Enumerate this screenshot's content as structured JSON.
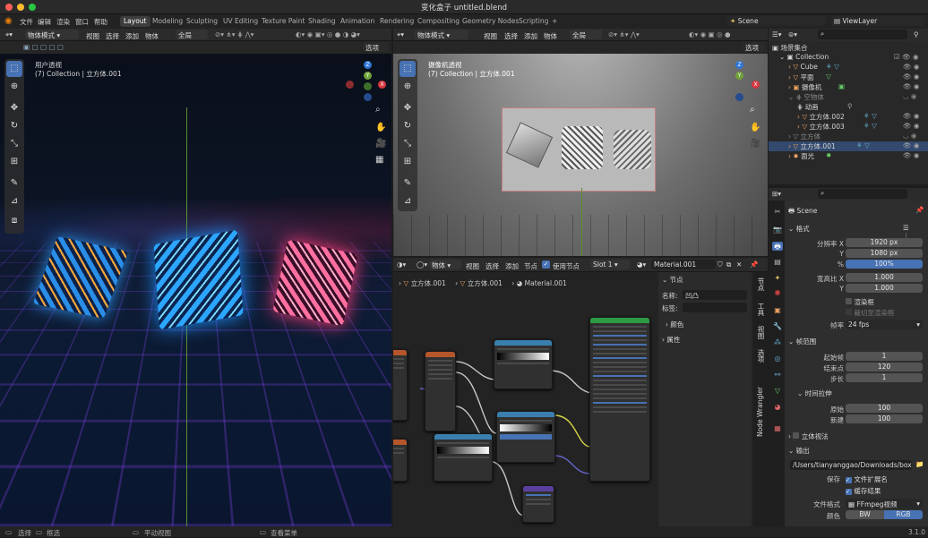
{
  "titlebar": {
    "title": "变化盒子 untitled.blend",
    "colors": {
      "close": "#ff5f57",
      "min": "#febc2e",
      "max": "#28c840"
    }
  },
  "menubar": {
    "items": [
      "文件",
      "编辑",
      "渲染",
      "窗口",
      "帮助"
    ],
    "tabs": [
      "Layout",
      "Modeling",
      "Sculpting",
      "UV Editing",
      "Texture Paint",
      "Shading",
      "Animation",
      "Rendering",
      "Compositing",
      "Geometry Nodes",
      "Scripting"
    ],
    "active_tab": "Layout",
    "add_tab": "+",
    "scene": "Scene",
    "viewlayer": "ViewLayer"
  },
  "viewport_left": {
    "mode": "物体模式",
    "menus": [
      "视图",
      "选择",
      "添加",
      "物体"
    ],
    "transform": "全局",
    "options": "选项",
    "label1": "用户透视",
    "label2": "(7) Collection | 立方体.001"
  },
  "viewport_right": {
    "mode": "物体模式",
    "menus": [
      "视图",
      "选择",
      "添加",
      "物体"
    ],
    "transform": "全局",
    "options": "选项",
    "label1": "摄像机透视",
    "label2": "(7) Collection | 立方体.001"
  },
  "axis": {
    "z": "Z",
    "y": "Y",
    "x": "X"
  },
  "node_editor": {
    "type": "物体",
    "menus": [
      "视图",
      "选择",
      "添加",
      "节点"
    ],
    "use_nodes": "使用节点",
    "slot": "Slot 1",
    "material": "Material.001",
    "breadcrumb": [
      "立方体.001",
      "立方体.001",
      "Material.001"
    ],
    "panel": {
      "node_header": "节点",
      "name_label": "名称:",
      "name_value": "凹凸",
      "label_label": "标签:",
      "color_label": "颜色",
      "props_label": "属性"
    },
    "sidebar_tabs": [
      "节点",
      "工具",
      "视图",
      "选项",
      "Node Wrangler"
    ]
  },
  "outliner": {
    "title": "场景集合",
    "search_placeholder": "",
    "items": [
      {
        "name": "Collection",
        "level": 0
      },
      {
        "name": "Cube",
        "level": 1
      },
      {
        "name": "平面",
        "level": 1
      },
      {
        "name": "摄像机",
        "level": 1
      },
      {
        "name": "空物体",
        "level": 1
      },
      {
        "name": "动画",
        "level": 2
      },
      {
        "name": "立方体.002",
        "level": 2
      },
      {
        "name": "立方体.003",
        "level": 2
      },
      {
        "name": "立方体",
        "level": 1
      },
      {
        "name": "立方体.001",
        "level": 1
      },
      {
        "name": "面光",
        "level": 1
      }
    ]
  },
  "properties": {
    "scene": "Scene",
    "format_header": "格式",
    "res_x_label": "分辨率 X",
    "res_x": "1920 px",
    "res_y_label": "Y",
    "res_y": "1080 px",
    "pct_label": "%",
    "pct": "100%",
    "aspect_x_label": "宽高比 X",
    "aspect_x": "1.000",
    "aspect_y_label": "Y",
    "aspect_y": "1.000",
    "render_region": "渲染框",
    "crop": "裁切至渲染框",
    "fps_label": "帧率",
    "fps": "24 fps",
    "frame_header": "帧范围",
    "start_label": "起始帧",
    "start": "1",
    "end_label": "结束点",
    "end": "120",
    "step_label": "步长",
    "step": "1",
    "time_stretch": "时间拉伸",
    "old_label": "原始",
    "old": "100",
    "new_label": "新建",
    "new": "100",
    "stereo": "立体视法",
    "output_header": "输出",
    "path": "/Users/tianyanggao/Downloads/box.mp4",
    "save_label": "保存",
    "file_ext": "文件扩展名",
    "cache": "缓存结果",
    "file_format_label": "文件格式",
    "file_format": "FFmpeg视频",
    "color_label": "颜色",
    "color_bw": "BW",
    "color_rgb": "RGB"
  },
  "statusbar": {
    "select": "选择",
    "box": "框选",
    "pan": "平动视图",
    "context": "查看菜单",
    "version": "3.1.0"
  }
}
